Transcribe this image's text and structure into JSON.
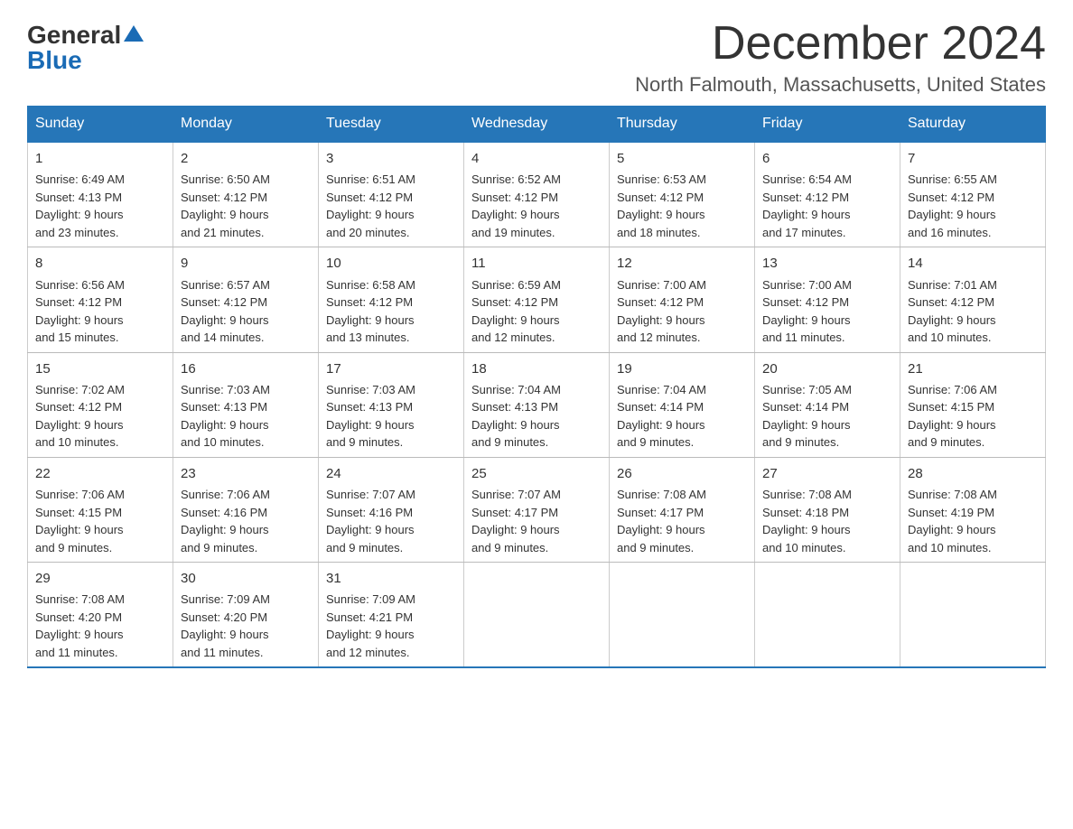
{
  "header": {
    "logo_general": "General",
    "logo_blue": "Blue",
    "month_title": "December 2024",
    "location": "North Falmouth, Massachusetts, United States"
  },
  "days_of_week": [
    "Sunday",
    "Monday",
    "Tuesday",
    "Wednesday",
    "Thursday",
    "Friday",
    "Saturday"
  ],
  "weeks": [
    [
      {
        "day": "1",
        "sunrise": "6:49 AM",
        "sunset": "4:13 PM",
        "daylight": "9 hours and 23 minutes."
      },
      {
        "day": "2",
        "sunrise": "6:50 AM",
        "sunset": "4:12 PM",
        "daylight": "9 hours and 21 minutes."
      },
      {
        "day": "3",
        "sunrise": "6:51 AM",
        "sunset": "4:12 PM",
        "daylight": "9 hours and 20 minutes."
      },
      {
        "day": "4",
        "sunrise": "6:52 AM",
        "sunset": "4:12 PM",
        "daylight": "9 hours and 19 minutes."
      },
      {
        "day": "5",
        "sunrise": "6:53 AM",
        "sunset": "4:12 PM",
        "daylight": "9 hours and 18 minutes."
      },
      {
        "day": "6",
        "sunrise": "6:54 AM",
        "sunset": "4:12 PM",
        "daylight": "9 hours and 17 minutes."
      },
      {
        "day": "7",
        "sunrise": "6:55 AM",
        "sunset": "4:12 PM",
        "daylight": "9 hours and 16 minutes."
      }
    ],
    [
      {
        "day": "8",
        "sunrise": "6:56 AM",
        "sunset": "4:12 PM",
        "daylight": "9 hours and 15 minutes."
      },
      {
        "day": "9",
        "sunrise": "6:57 AM",
        "sunset": "4:12 PM",
        "daylight": "9 hours and 14 minutes."
      },
      {
        "day": "10",
        "sunrise": "6:58 AM",
        "sunset": "4:12 PM",
        "daylight": "9 hours and 13 minutes."
      },
      {
        "day": "11",
        "sunrise": "6:59 AM",
        "sunset": "4:12 PM",
        "daylight": "9 hours and 12 minutes."
      },
      {
        "day": "12",
        "sunrise": "7:00 AM",
        "sunset": "4:12 PM",
        "daylight": "9 hours and 12 minutes."
      },
      {
        "day": "13",
        "sunrise": "7:00 AM",
        "sunset": "4:12 PM",
        "daylight": "9 hours and 11 minutes."
      },
      {
        "day": "14",
        "sunrise": "7:01 AM",
        "sunset": "4:12 PM",
        "daylight": "9 hours and 10 minutes."
      }
    ],
    [
      {
        "day": "15",
        "sunrise": "7:02 AM",
        "sunset": "4:12 PM",
        "daylight": "9 hours and 10 minutes."
      },
      {
        "day": "16",
        "sunrise": "7:03 AM",
        "sunset": "4:13 PM",
        "daylight": "9 hours and 10 minutes."
      },
      {
        "day": "17",
        "sunrise": "7:03 AM",
        "sunset": "4:13 PM",
        "daylight": "9 hours and 9 minutes."
      },
      {
        "day": "18",
        "sunrise": "7:04 AM",
        "sunset": "4:13 PM",
        "daylight": "9 hours and 9 minutes."
      },
      {
        "day": "19",
        "sunrise": "7:04 AM",
        "sunset": "4:14 PM",
        "daylight": "9 hours and 9 minutes."
      },
      {
        "day": "20",
        "sunrise": "7:05 AM",
        "sunset": "4:14 PM",
        "daylight": "9 hours and 9 minutes."
      },
      {
        "day": "21",
        "sunrise": "7:06 AM",
        "sunset": "4:15 PM",
        "daylight": "9 hours and 9 minutes."
      }
    ],
    [
      {
        "day": "22",
        "sunrise": "7:06 AM",
        "sunset": "4:15 PM",
        "daylight": "9 hours and 9 minutes."
      },
      {
        "day": "23",
        "sunrise": "7:06 AM",
        "sunset": "4:16 PM",
        "daylight": "9 hours and 9 minutes."
      },
      {
        "day": "24",
        "sunrise": "7:07 AM",
        "sunset": "4:16 PM",
        "daylight": "9 hours and 9 minutes."
      },
      {
        "day": "25",
        "sunrise": "7:07 AM",
        "sunset": "4:17 PM",
        "daylight": "9 hours and 9 minutes."
      },
      {
        "day": "26",
        "sunrise": "7:08 AM",
        "sunset": "4:17 PM",
        "daylight": "9 hours and 9 minutes."
      },
      {
        "day": "27",
        "sunrise": "7:08 AM",
        "sunset": "4:18 PM",
        "daylight": "9 hours and 10 minutes."
      },
      {
        "day": "28",
        "sunrise": "7:08 AM",
        "sunset": "4:19 PM",
        "daylight": "9 hours and 10 minutes."
      }
    ],
    [
      {
        "day": "29",
        "sunrise": "7:08 AM",
        "sunset": "4:20 PM",
        "daylight": "9 hours and 11 minutes."
      },
      {
        "day": "30",
        "sunrise": "7:09 AM",
        "sunset": "4:20 PM",
        "daylight": "9 hours and 11 minutes."
      },
      {
        "day": "31",
        "sunrise": "7:09 AM",
        "sunset": "4:21 PM",
        "daylight": "9 hours and 12 minutes."
      },
      null,
      null,
      null,
      null
    ]
  ],
  "labels": {
    "sunrise": "Sunrise:",
    "sunset": "Sunset:",
    "daylight": "Daylight:"
  }
}
